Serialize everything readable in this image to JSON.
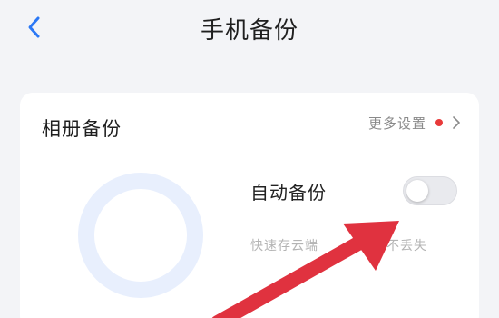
{
  "header": {
    "title": "手机备份",
    "back_icon": "chevron-left-icon"
  },
  "album_backup": {
    "title": "相册备份",
    "more_settings_label": "更多设置",
    "notification_dot_color": "#e83a3a",
    "auto_backup_label": "自动备份",
    "auto_backup_enabled": false,
    "description_left": "快速存云端",
    "description_right": "不丢失"
  },
  "colors": {
    "accent": "#2b78f5",
    "arrow": "#e0323f",
    "background": "#f3f4f7"
  }
}
